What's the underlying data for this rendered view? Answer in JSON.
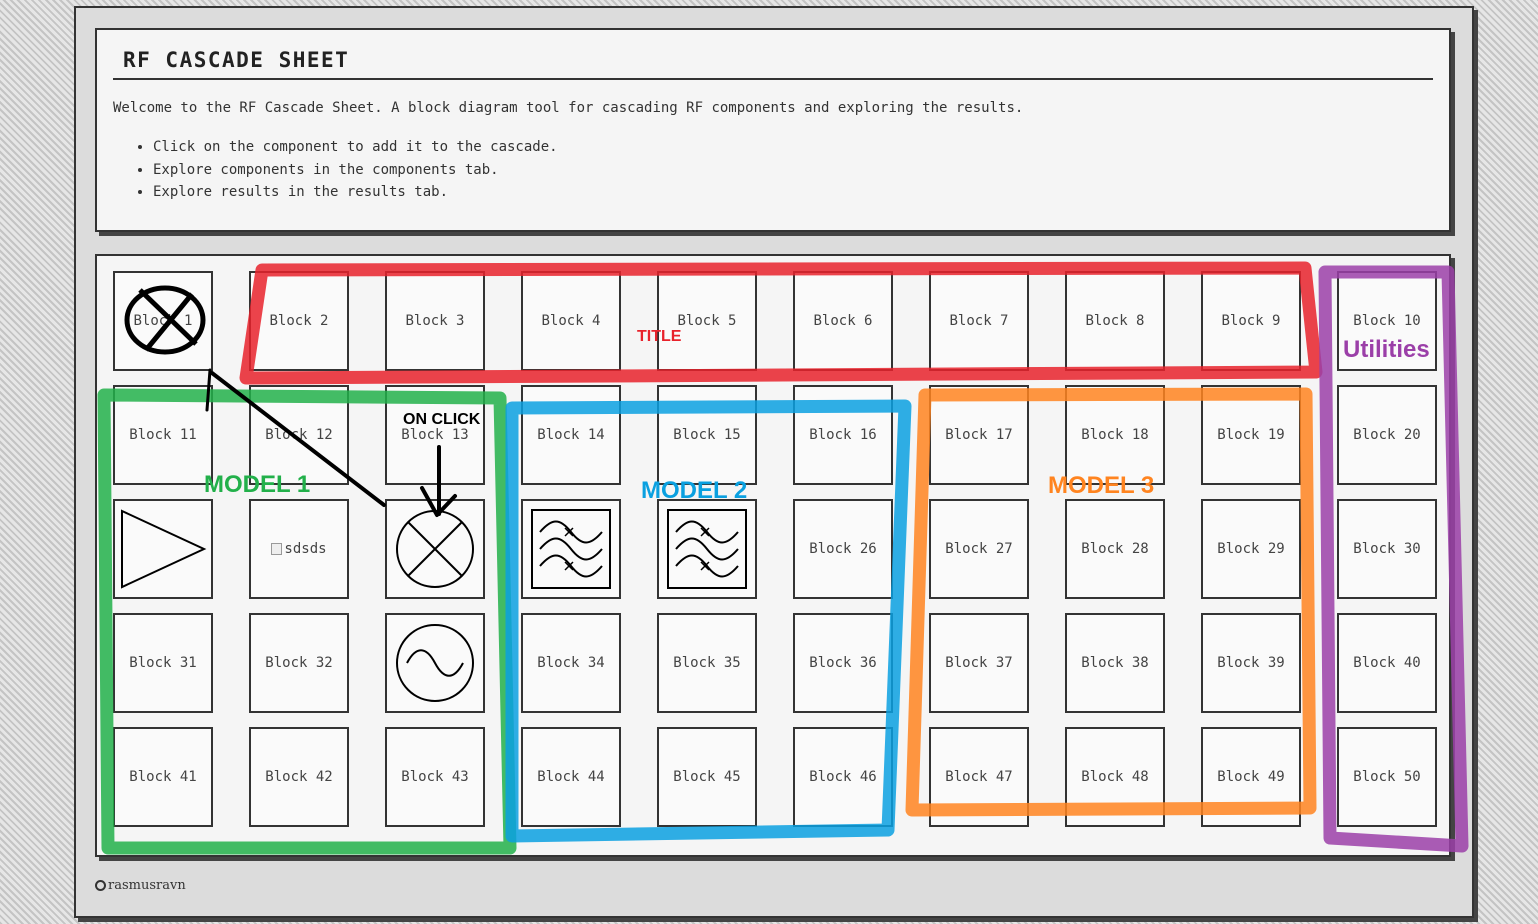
{
  "header": {
    "title": "RF CASCADE SHEET",
    "welcome": "Welcome to the RF Cascade Sheet. A block diagram tool for cascading RF components and exploring the results.",
    "bullets": [
      "Click on the component to add it to the cascade.",
      "Explore components in the components tab.",
      "Explore results in the results tab."
    ]
  },
  "blocks": [
    {
      "label": "Block 1",
      "icon": "crossed-out-mixer"
    },
    {
      "label": "Block 2"
    },
    {
      "label": "Block 3"
    },
    {
      "label": "Block 4"
    },
    {
      "label": "Block 5"
    },
    {
      "label": "Block 6"
    },
    {
      "label": "Block 7"
    },
    {
      "label": "Block 8"
    },
    {
      "label": "Block 9"
    },
    {
      "label": "Block 10"
    },
    {
      "label": "Block 11"
    },
    {
      "label": "Block 12"
    },
    {
      "label": "Block 13"
    },
    {
      "label": "Block 14"
    },
    {
      "label": "Block 15"
    },
    {
      "label": "Block 16"
    },
    {
      "label": "Block 17"
    },
    {
      "label": "Block 18"
    },
    {
      "label": "Block 19"
    },
    {
      "label": "Block 20"
    },
    {
      "label": "",
      "icon": "amplifier"
    },
    {
      "label": "sdsds",
      "icon": "broken-image"
    },
    {
      "label": "",
      "icon": "mixer"
    },
    {
      "label": "",
      "icon": "bandpass-filter"
    },
    {
      "label": "",
      "icon": "bandpass-filter"
    },
    {
      "label": "Block 26"
    },
    {
      "label": "Block 27"
    },
    {
      "label": "Block 28"
    },
    {
      "label": "Block 29"
    },
    {
      "label": "Block 30"
    },
    {
      "label": "Block 31"
    },
    {
      "label": "Block 32"
    },
    {
      "label": "",
      "icon": "oscillator"
    },
    {
      "label": "Block 34"
    },
    {
      "label": "Block 35"
    },
    {
      "label": "Block 36"
    },
    {
      "label": "Block 37"
    },
    {
      "label": "Block 38"
    },
    {
      "label": "Block 39"
    },
    {
      "label": "Block 40"
    },
    {
      "label": "Block 41"
    },
    {
      "label": "Block 42"
    },
    {
      "label": "Block 43"
    },
    {
      "label": "Block 44"
    },
    {
      "label": "Block 45"
    },
    {
      "label": "Block 46"
    },
    {
      "label": "Block 47"
    },
    {
      "label": "Block 48"
    },
    {
      "label": "Block 49"
    },
    {
      "label": "Block 50"
    }
  ],
  "annotations": {
    "title": {
      "text": "TITLE",
      "color": "#e8222b"
    },
    "utilities": {
      "text": "Utilities",
      "color": "#9b3fa8"
    },
    "on_click": {
      "text": "ON CLICK",
      "color": "#000000"
    },
    "model1": {
      "text": "MODEL 1",
      "color": "#22b04a"
    },
    "model2": {
      "text": "MODEL 2",
      "color": "#0aa0e0"
    },
    "model3": {
      "text": "MODEL 3",
      "color": "#ff8420"
    }
  },
  "footer": {
    "username": "rasmusravn",
    "icon": "github-icon"
  }
}
